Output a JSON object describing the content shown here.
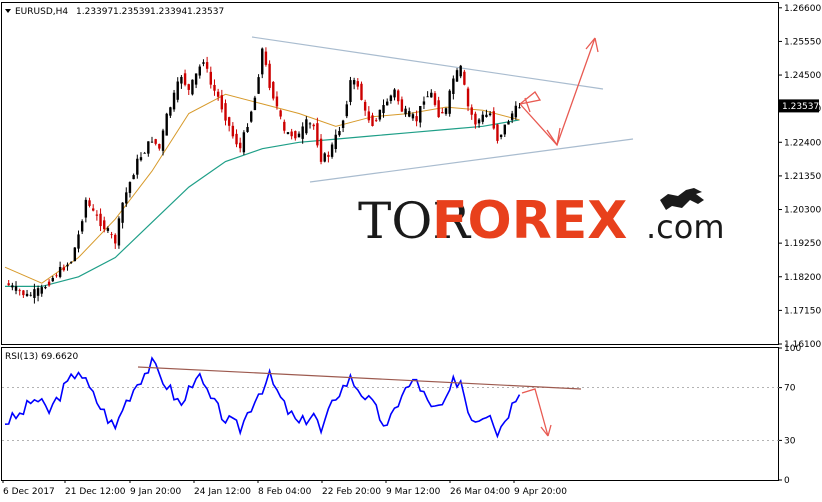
{
  "chart_data": [
    {
      "type": "candlestick",
      "symbol_label": "EURUSD,H4",
      "ohlc_header": [
        "1.23397",
        "1.23539",
        "1.23394",
        "1.23537"
      ],
      "current_price_label": "1.23537",
      "price_axis_ticks": [
        "1.26600",
        "1.25550",
        "1.24500",
        "1.23450",
        "1.22400",
        "1.21350",
        "1.20300",
        "1.19250",
        "1.18200",
        "1.17150",
        "1.16100"
      ],
      "price_tick_values": [
        1.266,
        1.2555,
        1.245,
        1.2345,
        1.224,
        1.2135,
        1.203,
        1.1925,
        1.182,
        1.1715,
        1.161
      ],
      "ylim": [
        1.161,
        1.2675
      ],
      "x_axis_labels": [
        "6 Dec 2017",
        "21 Dec 12:00",
        "9 Jan 20:00",
        "24 Jan 12:00",
        "8 Feb 04:00",
        "22 Feb 20:00",
        "9 Mar 12:00",
        "26 Mar 04:00",
        "9 Apr 20:00"
      ],
      "price_path": [
        [
          0,
          1.18
        ],
        [
          3,
          1.176
        ],
        [
          5,
          1.178
        ],
        [
          7,
          1.183
        ],
        [
          9,
          1.187
        ],
        [
          10,
          1.195
        ],
        [
          11,
          1.206
        ],
        [
          12,
          1.202
        ],
        [
          14,
          1.196
        ],
        [
          15,
          1.193
        ],
        [
          16,
          1.205
        ],
        [
          18,
          1.218
        ],
        [
          20,
          1.225
        ],
        [
          21,
          1.222
        ],
        [
          22,
          1.232
        ],
        [
          24,
          1.245
        ],
        [
          25,
          1.24
        ],
        [
          27,
          1.25
        ],
        [
          28,
          1.242
        ],
        [
          29,
          1.238
        ],
        [
          31,
          1.226
        ],
        [
          32,
          1.222
        ],
        [
          34,
          1.238
        ],
        [
          35,
          1.253
        ],
        [
          36,
          1.242
        ],
        [
          37,
          1.235
        ],
        [
          38,
          1.227
        ],
        [
          40,
          1.226
        ],
        [
          41,
          1.23
        ],
        [
          42,
          1.229
        ],
        [
          43,
          1.219
        ],
        [
          44,
          1.22
        ],
        [
          46,
          1.231
        ],
        [
          47,
          1.243
        ],
        [
          48,
          1.242
        ],
        [
          49,
          1.233
        ],
        [
          50,
          1.23
        ],
        [
          52,
          1.237
        ],
        [
          53,
          1.24
        ],
        [
          54,
          1.234
        ],
        [
          56,
          1.231
        ],
        [
          57,
          1.238
        ],
        [
          58,
          1.239
        ],
        [
          59,
          1.233
        ],
        [
          60,
          1.234
        ],
        [
          61,
          1.244
        ],
        [
          62,
          1.247
        ],
        [
          63,
          1.235
        ],
        [
          64,
          1.23
        ],
        [
          65,
          1.232
        ],
        [
          66,
          1.233
        ],
        [
          67,
          1.225
        ],
        [
          68,
          1.229
        ],
        [
          69,
          1.233
        ],
        [
          70,
          1.2354
        ]
      ],
      "ma_slow_path": [
        [
          0,
          1.179
        ],
        [
          5,
          1.179
        ],
        [
          10,
          1.182
        ],
        [
          15,
          1.188
        ],
        [
          20,
          1.199
        ],
        [
          25,
          1.21
        ],
        [
          30,
          1.218
        ],
        [
          35,
          1.222
        ],
        [
          40,
          1.224
        ],
        [
          45,
          1.225
        ],
        [
          50,
          1.226
        ],
        [
          55,
          1.227
        ],
        [
          60,
          1.228
        ],
        [
          65,
          1.229
        ],
        [
          70,
          1.231
        ]
      ],
      "ma_fast_path": [
        [
          0,
          1.185
        ],
        [
          5,
          1.18
        ],
        [
          10,
          1.188
        ],
        [
          15,
          1.2
        ],
        [
          20,
          1.215
        ],
        [
          25,
          1.233
        ],
        [
          30,
          1.239
        ],
        [
          35,
          1.236
        ],
        [
          40,
          1.233
        ],
        [
          45,
          1.229
        ],
        [
          50,
          1.232
        ],
        [
          55,
          1.233
        ],
        [
          60,
          1.235
        ],
        [
          65,
          1.234
        ],
        [
          70,
          1.231
        ]
      ],
      "trendline_upper": [
        [
          35,
          1.258
        ],
        [
          85,
          1.241
        ]
      ],
      "trendline_lower": [
        [
          43,
          1.214
        ],
        [
          88,
          1.2255
        ]
      ],
      "forecast_wave": [
        [
          71,
          1.238
        ],
        [
          76,
          1.226
        ],
        [
          82,
          1.257
        ]
      ],
      "colors": {
        "up_candle": "#000000",
        "down_candle": "#cc0000",
        "ma_fast": "#d79a2b",
        "ma_slow": "#1f9f88",
        "trendline": "#a9bccf",
        "forecast": "#e85a52"
      }
    },
    {
      "type": "line",
      "indicator_label": "RSI(13) 69.6620",
      "axis_ticks": [
        "100",
        "70",
        "30",
        "0"
      ],
      "tick_values": [
        100,
        70,
        30,
        0
      ],
      "ylim": [
        0,
        100
      ],
      "series": [
        {
          "values": [
            [
              0,
              44
            ],
            [
              2,
              49
            ],
            [
              4,
              62
            ],
            [
              6,
              52
            ],
            [
              8,
              69
            ],
            [
              10,
              84
            ],
            [
              12,
              64
            ],
            [
              14,
              47
            ],
            [
              15,
              39
            ],
            [
              16,
              55
            ],
            [
              18,
              74
            ],
            [
              20,
              88
            ],
            [
              22,
              72
            ],
            [
              24,
              56
            ],
            [
              26,
              81
            ],
            [
              28,
              61
            ],
            [
              30,
              46
            ],
            [
              32,
              39
            ],
            [
              34,
              62
            ],
            [
              36,
              78
            ],
            [
              38,
              56
            ],
            [
              40,
              42
            ],
            [
              42,
              51
            ],
            [
              43,
              36
            ],
            [
              45,
              64
            ],
            [
              47,
              77
            ],
            [
              48,
              70
            ],
            [
              50,
              57
            ],
            [
              52,
              39
            ],
            [
              54,
              66
            ],
            [
              56,
              76
            ],
            [
              58,
              53
            ],
            [
              60,
              58
            ],
            [
              61,
              74
            ],
            [
              62,
              76
            ],
            [
              63,
              53
            ],
            [
              64,
              46
            ],
            [
              66,
              53
            ],
            [
              67,
              36
            ],
            [
              69,
              57
            ],
            [
              70,
              69.66
            ]
          ]
        }
      ],
      "trendline": [
        [
          16,
          91
        ],
        [
          84,
          76
        ]
      ],
      "forecast_wave": [
        [
          71,
          71
        ],
        [
          75,
          40
        ]
      ],
      "colors": {
        "rsi": "#0000ff",
        "trendline": "#9d5a4f",
        "forecast": "#e85a52"
      }
    }
  ],
  "watermark": {
    "part1": "TOR",
    "part2": "FOREX",
    "part3": ".com"
  }
}
